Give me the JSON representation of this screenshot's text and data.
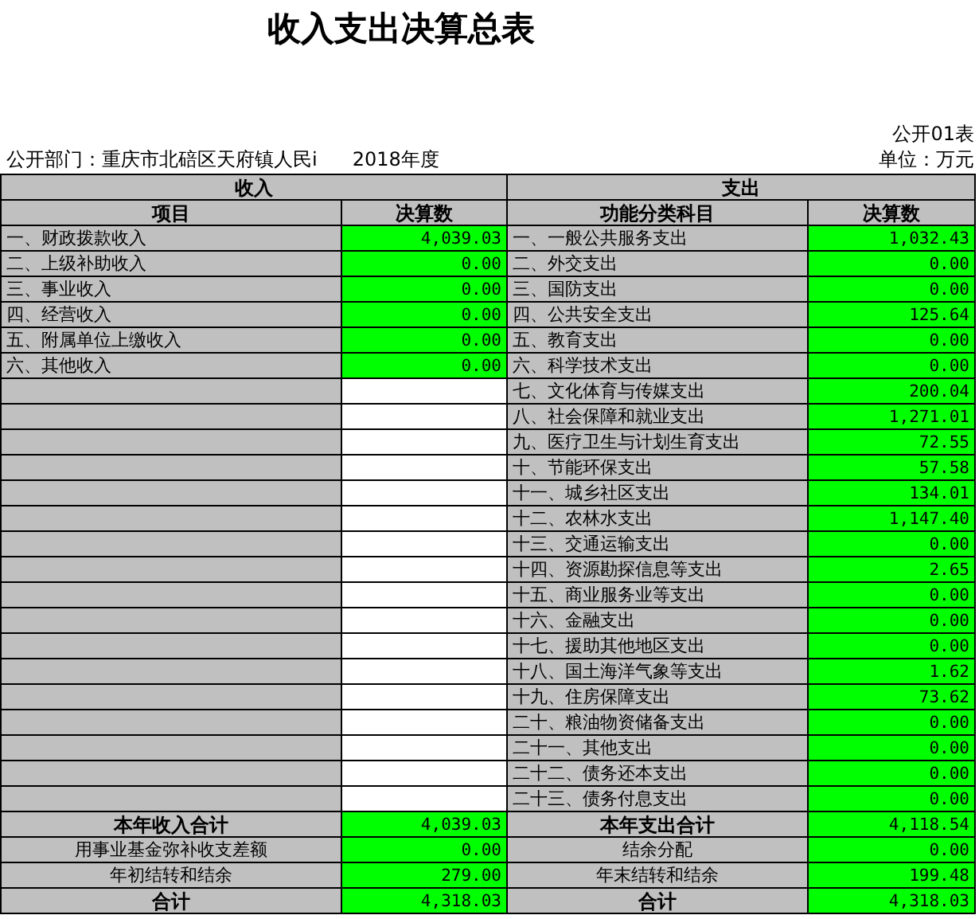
{
  "title": "收入支出决算总表",
  "form_code": "公开01表",
  "department": "公开部门：重庆市北碚区天府镇人民i",
  "year": "2018年度",
  "unit": "单位：万元",
  "section_headers": [
    "收入",
    "支出"
  ],
  "columns": [
    "项目",
    "决算数",
    "功能分类科目",
    "决算数"
  ],
  "income_rows": [
    {
      "item": "一、财政拨款收入",
      "amount": "4,039.03"
    },
    {
      "item": "二、上级补助收入",
      "amount": "0.00"
    },
    {
      "item": "三、事业收入",
      "amount": "0.00"
    },
    {
      "item": "四、经营收入",
      "amount": "0.00"
    },
    {
      "item": "五、附属单位上缴收入",
      "amount": "0.00"
    },
    {
      "item": "六、其他收入",
      "amount": "0.00"
    }
  ],
  "expense_rows": [
    {
      "item": "一、一般公共服务支出",
      "amount": "1,032.43"
    },
    {
      "item": "二、外交支出",
      "amount": "0.00"
    },
    {
      "item": "三、国防支出",
      "amount": "0.00"
    },
    {
      "item": "四、公共安全支出",
      "amount": "125.64"
    },
    {
      "item": "五、教育支出",
      "amount": "0.00"
    },
    {
      "item": "六、科学技术支出",
      "amount": "0.00"
    },
    {
      "item": "七、文化体育与传媒支出",
      "amount": "200.04"
    },
    {
      "item": "八、社会保障和就业支出",
      "amount": "1,271.01"
    },
    {
      "item": "九、医疗卫生与计划生育支出",
      "amount": "72.55"
    },
    {
      "item": "十、节能环保支出",
      "amount": "57.58"
    },
    {
      "item": "十一、城乡社区支出",
      "amount": "134.01"
    },
    {
      "item": "十二、农林水支出",
      "amount": "1,147.40"
    },
    {
      "item": "十三、交通运输支出",
      "amount": "0.00"
    },
    {
      "item": "十四、资源勘探信息等支出",
      "amount": "2.65"
    },
    {
      "item": "十五、商业服务业等支出",
      "amount": "0.00"
    },
    {
      "item": "十六、金融支出",
      "amount": "0.00"
    },
    {
      "item": "十七、援助其他地区支出",
      "amount": "0.00"
    },
    {
      "item": "十八、国土海洋气象等支出",
      "amount": "1.62"
    },
    {
      "item": "十九、住房保障支出",
      "amount": "73.62"
    },
    {
      "item": "二十、粮油物资储备支出",
      "amount": "0.00"
    },
    {
      "item": "二十一、其他支出",
      "amount": "0.00"
    },
    {
      "item": "二十二、债务还本支出",
      "amount": "0.00"
    },
    {
      "item": "二十三、债务付息支出",
      "amount": "0.00"
    }
  ],
  "summary_rows": [
    {
      "kind": "total",
      "income_label": "本年收入合计",
      "income_amount": "4,039.03",
      "expense_label": "本年支出合计",
      "expense_amount": "4,118.54"
    },
    {
      "kind": "sub",
      "income_label": "用事业基金弥补收支差额",
      "income_amount": "0.00",
      "expense_label": "结余分配",
      "expense_amount": "0.00"
    },
    {
      "kind": "sub",
      "income_label": "年初结转和结余",
      "income_amount": "279.00",
      "expense_label": "年末结转和结余",
      "expense_amount": "199.48"
    },
    {
      "kind": "total",
      "income_label": "合计",
      "income_amount": "4,318.03",
      "expense_label": "合计",
      "expense_amount": "4,318.03"
    }
  ]
}
